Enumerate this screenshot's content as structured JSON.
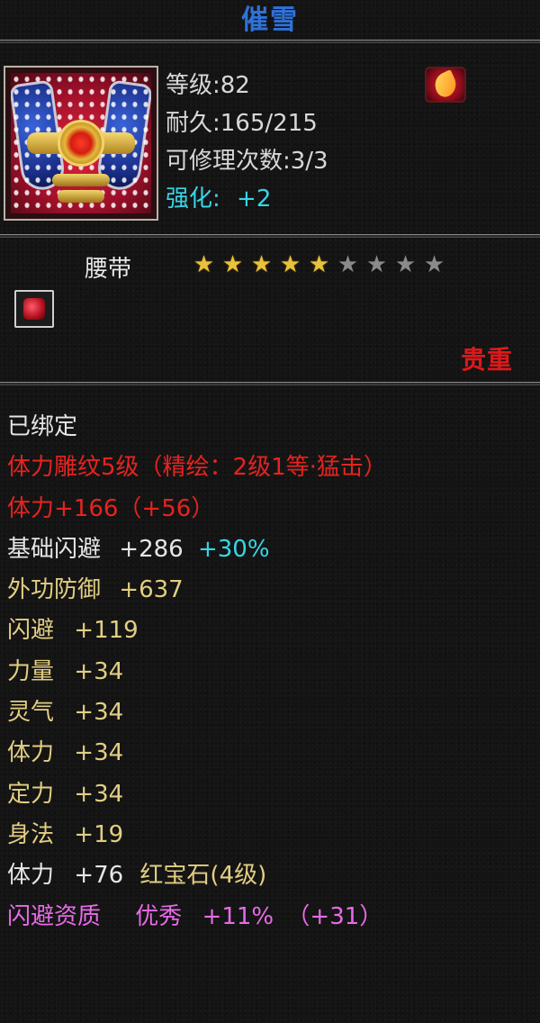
{
  "title": {
    "text": "催雪",
    "color": "#2f72d8"
  },
  "header": {
    "level": "等级:82",
    "durability": "耐久:165/215",
    "repairs": "可修理次数:3/3",
    "enhance_label": "强化:",
    "enhance_value": "+2"
  },
  "item": {
    "type": "腰带",
    "stars_filled": 5,
    "stars_total": 9,
    "rarity": "贵重",
    "icon": "belt-armor-icon",
    "bind_icon": "bound-flame-icon",
    "socket_icon": "ruby-gem-icon"
  },
  "attributes": {
    "bound": "已绑定",
    "engrave_main": "体力雕纹5级（精绘：2级1等·猛击）",
    "stamina_base": "体力+166",
    "stamina_bonus": "（+56）",
    "dodge_base_label": "基础闪避",
    "dodge_base_value": "+286",
    "dodge_base_pct": "+30%",
    "ext_def_label": "外功防御",
    "ext_def_value": "+637",
    "dodge_label": "闪避",
    "dodge_value": "+119",
    "strength_label": "力量",
    "strength_value": "+34",
    "spirit_label": "灵气",
    "spirit_value": "+34",
    "stamina_label": "体力",
    "stamina_value": "+34",
    "focus_label": "定力",
    "focus_value": "+34",
    "agility_label": "身法",
    "agility_value": "+19",
    "gem_label": "体力",
    "gem_value": "+76",
    "gem_name": "红宝石(4级)",
    "aptitude_label": "闪避资质",
    "aptitude_grade": "优秀",
    "aptitude_value": "+11%",
    "aptitude_bonus": "（+31）"
  },
  "colors": {
    "white": "#e6e6e6",
    "red": "#e6231f",
    "gold": "#e2ce82",
    "cyan": "#37d6e6",
    "pink": "#e86ae8",
    "title_blue": "#2f72d8"
  }
}
